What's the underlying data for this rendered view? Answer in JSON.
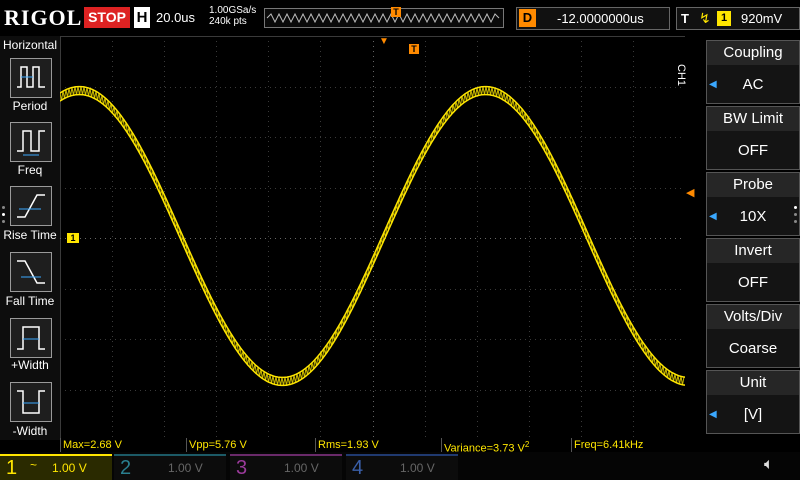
{
  "top": {
    "logo": "RIGOL",
    "run_state": "STOP",
    "horizontal_letter": "H",
    "timebase": "20.0us",
    "sample_rate": "1.00GSa/s",
    "memory_depth": "240k pts",
    "trigger_marker": "T",
    "delay_letter": "D",
    "delay": "-12.0000000us",
    "trigger_letter": "T",
    "trigger_edge": "↯",
    "trigger_channel": "1",
    "trigger_level": "920mV"
  },
  "left_menu": {
    "title": "Horizontal",
    "items": [
      {
        "label": "Period",
        "icon": "period-icon"
      },
      {
        "label": "Freq",
        "icon": "freq-icon"
      },
      {
        "label": "Rise Time",
        "icon": "rise-time-icon"
      },
      {
        "label": "Fall Time",
        "icon": "fall-time-icon"
      },
      {
        "label": "+Width",
        "icon": "pos-width-icon"
      },
      {
        "label": "-Width",
        "icon": "neg-width-icon"
      }
    ]
  },
  "right_menu": {
    "channel_tab": "CH1",
    "items": [
      {
        "label": "Coupling",
        "value": "AC",
        "has_arrow": true
      },
      {
        "label": "BW Limit",
        "value": "OFF",
        "has_arrow": false
      },
      {
        "label": "Probe",
        "value": "10X",
        "has_arrow": true
      },
      {
        "label": "Invert",
        "value": "OFF",
        "has_arrow": false
      },
      {
        "label": "Volts/Div",
        "value": "Coarse",
        "has_arrow": false
      },
      {
        "label": "Unit",
        "value": "[V]",
        "has_arrow": true
      }
    ]
  },
  "markers": {
    "ch1_ground": "1",
    "trigger_top": "T"
  },
  "measurements": {
    "max": "Max=2.68 V",
    "vpp": "Vpp=5.76 V",
    "rms": "Rms=1.93 V",
    "variance": "Variance=3.73 V",
    "variance_sup": "2",
    "freq": "Freq=6.41kHz"
  },
  "channels": [
    {
      "num": "1",
      "coupling": "~",
      "scale": "1.00 V",
      "color": "#ffe600",
      "active": true
    },
    {
      "num": "2",
      "coupling": "",
      "scale": "1.00 V",
      "color": "#00d0ff",
      "active": false
    },
    {
      "num": "3",
      "coupling": "",
      "scale": "1.00 V",
      "color": "#e040e0",
      "active": false
    },
    {
      "num": "4",
      "coupling": "",
      "scale": "1.00 V",
      "color": "#3a7dff",
      "active": false
    }
  ],
  "colors": {
    "ch1": "#ffe600",
    "trigger": "#ff8a00",
    "stop": "#dd2222",
    "accent": "#3aa8ff"
  },
  "waveform": {
    "shape": "sine",
    "amplitude_v": 2.88,
    "offset_v": 0,
    "frequency_khz": 6.41,
    "ripple": true
  }
}
